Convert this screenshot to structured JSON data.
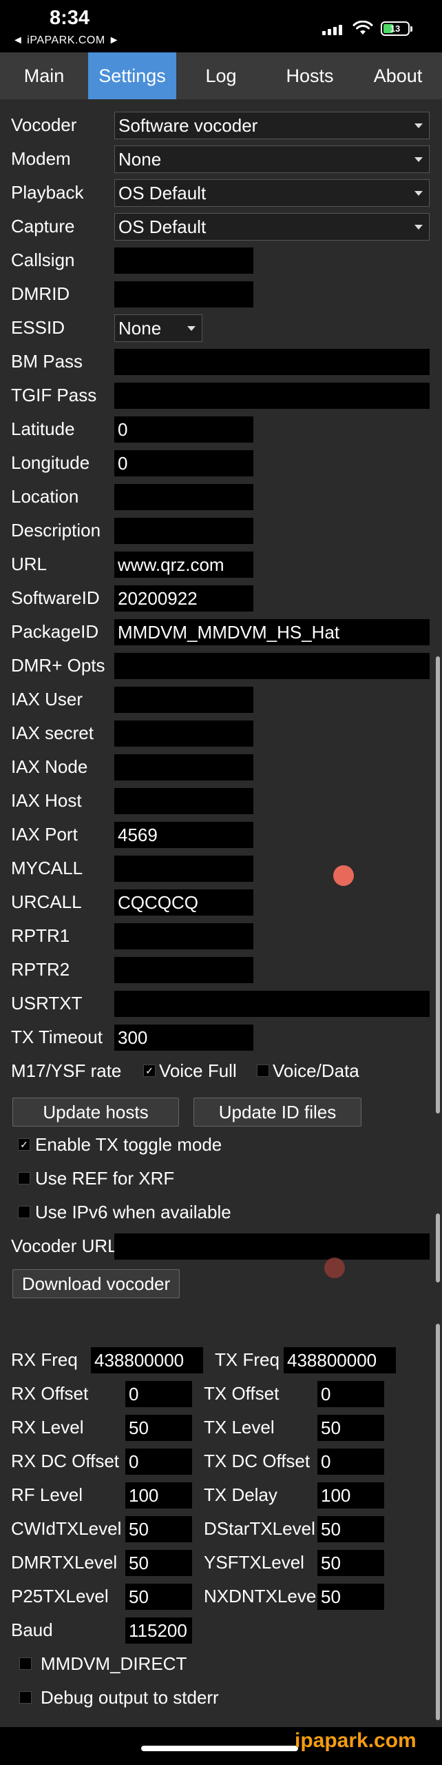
{
  "status": {
    "time": "8:34",
    "back_label": "◄ iPAPARK.COM ►",
    "battery": "13"
  },
  "tabs": [
    "Main",
    "Settings",
    "Log",
    "Hosts",
    "About"
  ],
  "active_tab": "Settings",
  "settings": {
    "vocoder": {
      "label": "Vocoder",
      "value": "Software vocoder"
    },
    "modem": {
      "label": "Modem",
      "value": "None"
    },
    "playback": {
      "label": "Playback",
      "value": "OS Default"
    },
    "capture": {
      "label": "Capture",
      "value": "OS Default"
    },
    "callsign": {
      "label": "Callsign",
      "value": ""
    },
    "dmrid": {
      "label": "DMRID",
      "value": ""
    },
    "essid": {
      "label": "ESSID",
      "value": "None"
    },
    "bm_pass": {
      "label": "BM Pass",
      "value": ""
    },
    "tgif_pass": {
      "label": "TGIF Pass",
      "value": ""
    },
    "latitude": {
      "label": "Latitude",
      "value": "0"
    },
    "longitude": {
      "label": "Longitude",
      "value": "0"
    },
    "location": {
      "label": "Location",
      "value": ""
    },
    "description": {
      "label": "Description",
      "value": ""
    },
    "url": {
      "label": "URL",
      "value": "www.qrz.com"
    },
    "software_id": {
      "label": "SoftwareID",
      "value": "20200922"
    },
    "package_id": {
      "label": "PackageID",
      "value": "MMDVM_MMDVM_HS_Hat"
    },
    "dmr_opts": {
      "label": "DMR+ Opts",
      "value": ""
    },
    "iax_user": {
      "label": "IAX User",
      "value": ""
    },
    "iax_secret": {
      "label": "IAX secret",
      "value": ""
    },
    "iax_node": {
      "label": "IAX Node",
      "value": ""
    },
    "iax_host": {
      "label": "IAX Host",
      "value": ""
    },
    "iax_port": {
      "label": "IAX Port",
      "value": "4569"
    },
    "mycall": {
      "label": "MYCALL",
      "value": ""
    },
    "urcall": {
      "label": "URCALL",
      "value": "CQCQCQ"
    },
    "rptr1": {
      "label": "RPTR1",
      "value": ""
    },
    "rptr2": {
      "label": "RPTR2",
      "value": ""
    },
    "usrtxt": {
      "label": "USRTXT",
      "value": ""
    },
    "tx_timeout": {
      "label": "TX Timeout",
      "value": "300"
    },
    "m17_rate": {
      "label": "M17/YSF rate",
      "voice_full": "Voice Full",
      "voice_data": "Voice/Data",
      "voice_full_checked": true,
      "voice_data_checked": false
    },
    "update_hosts": "Update hosts",
    "update_id_files": "Update ID files",
    "enable_tx_toggle": {
      "label": "Enable TX toggle mode",
      "checked": true
    },
    "use_ref_xrf": {
      "label": "Use REF for XRF",
      "checked": false
    },
    "use_ipv6": {
      "label": "Use IPv6 when available",
      "checked": false
    },
    "vocoder_url": {
      "label": "Vocoder URL",
      "value": ""
    },
    "download_vocoder": "Download vocoder"
  },
  "rf": {
    "rx_freq": {
      "label": "RX Freq",
      "value": "438800000"
    },
    "tx_freq": {
      "label": "TX Freq",
      "value": "438800000"
    },
    "rx_offset": {
      "label": "RX Offset",
      "value": "0"
    },
    "tx_offset": {
      "label": "TX Offset",
      "value": "0"
    },
    "rx_level": {
      "label": "RX Level",
      "value": "50"
    },
    "tx_level": {
      "label": "TX Level",
      "value": "50"
    },
    "rx_dc_offset": {
      "label": "RX DC Offset",
      "value": "0"
    },
    "tx_dc_offset": {
      "label": "TX DC Offset",
      "value": "0"
    },
    "rf_level": {
      "label": "RF Level",
      "value": "100"
    },
    "tx_delay": {
      "label": "TX Delay",
      "value": "100"
    },
    "cwid_tx_level": {
      "label": "CWIdTXLevel",
      "value": "50"
    },
    "dstar_tx_level": {
      "label": "DStarTXLevel",
      "value": "50"
    },
    "dmr_tx_level": {
      "label": "DMRTXLevel",
      "value": "50"
    },
    "ysf_tx_level": {
      "label": "YSFTXLevel",
      "value": "50"
    },
    "p25_tx_level": {
      "label": "P25TXLevel",
      "value": "50"
    },
    "nxdn_tx_level": {
      "label": "NXDNTXLevel",
      "value": "50"
    },
    "baud": {
      "label": "Baud",
      "value": "115200"
    },
    "mmdvm_direct": {
      "label": "MMDVM_DIRECT",
      "checked": false
    },
    "debug_output": {
      "label": "Debug output to stderr",
      "checked": false
    }
  },
  "watermark": "ipapark.com"
}
